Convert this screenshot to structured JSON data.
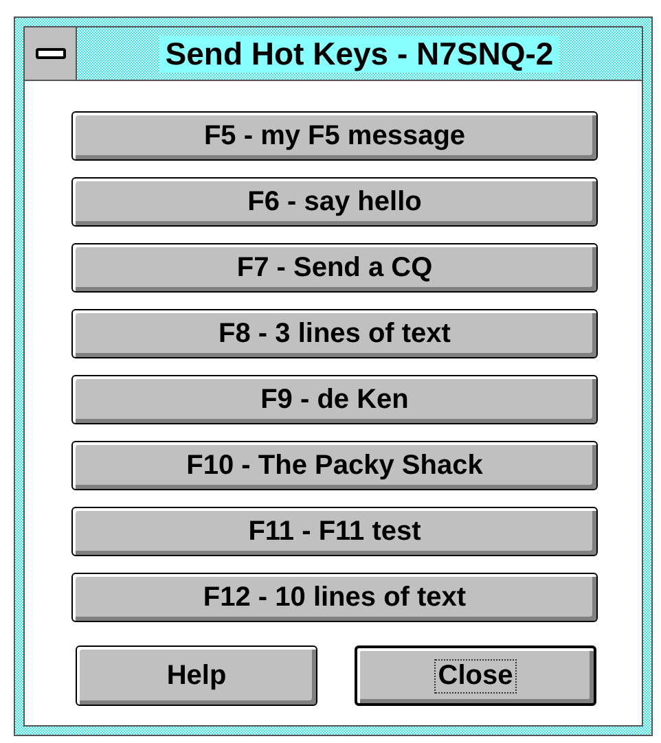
{
  "window": {
    "title": "Send Hot Keys - N7SNQ-2"
  },
  "hot_keys": [
    {
      "label": "F5 - my F5 message"
    },
    {
      "label": "F6 - say hello"
    },
    {
      "label": "F7 - Send a CQ"
    },
    {
      "label": "F8 - 3 lines of text"
    },
    {
      "label": "F9 - de Ken"
    },
    {
      "label": "F10 - The Packy Shack"
    },
    {
      "label": "F11 - F11 test"
    },
    {
      "label": "F12 - 10 lines of text"
    }
  ],
  "buttons": [
    {
      "label": "Help",
      "focused": false
    },
    {
      "label": "Close",
      "focused": true
    }
  ]
}
